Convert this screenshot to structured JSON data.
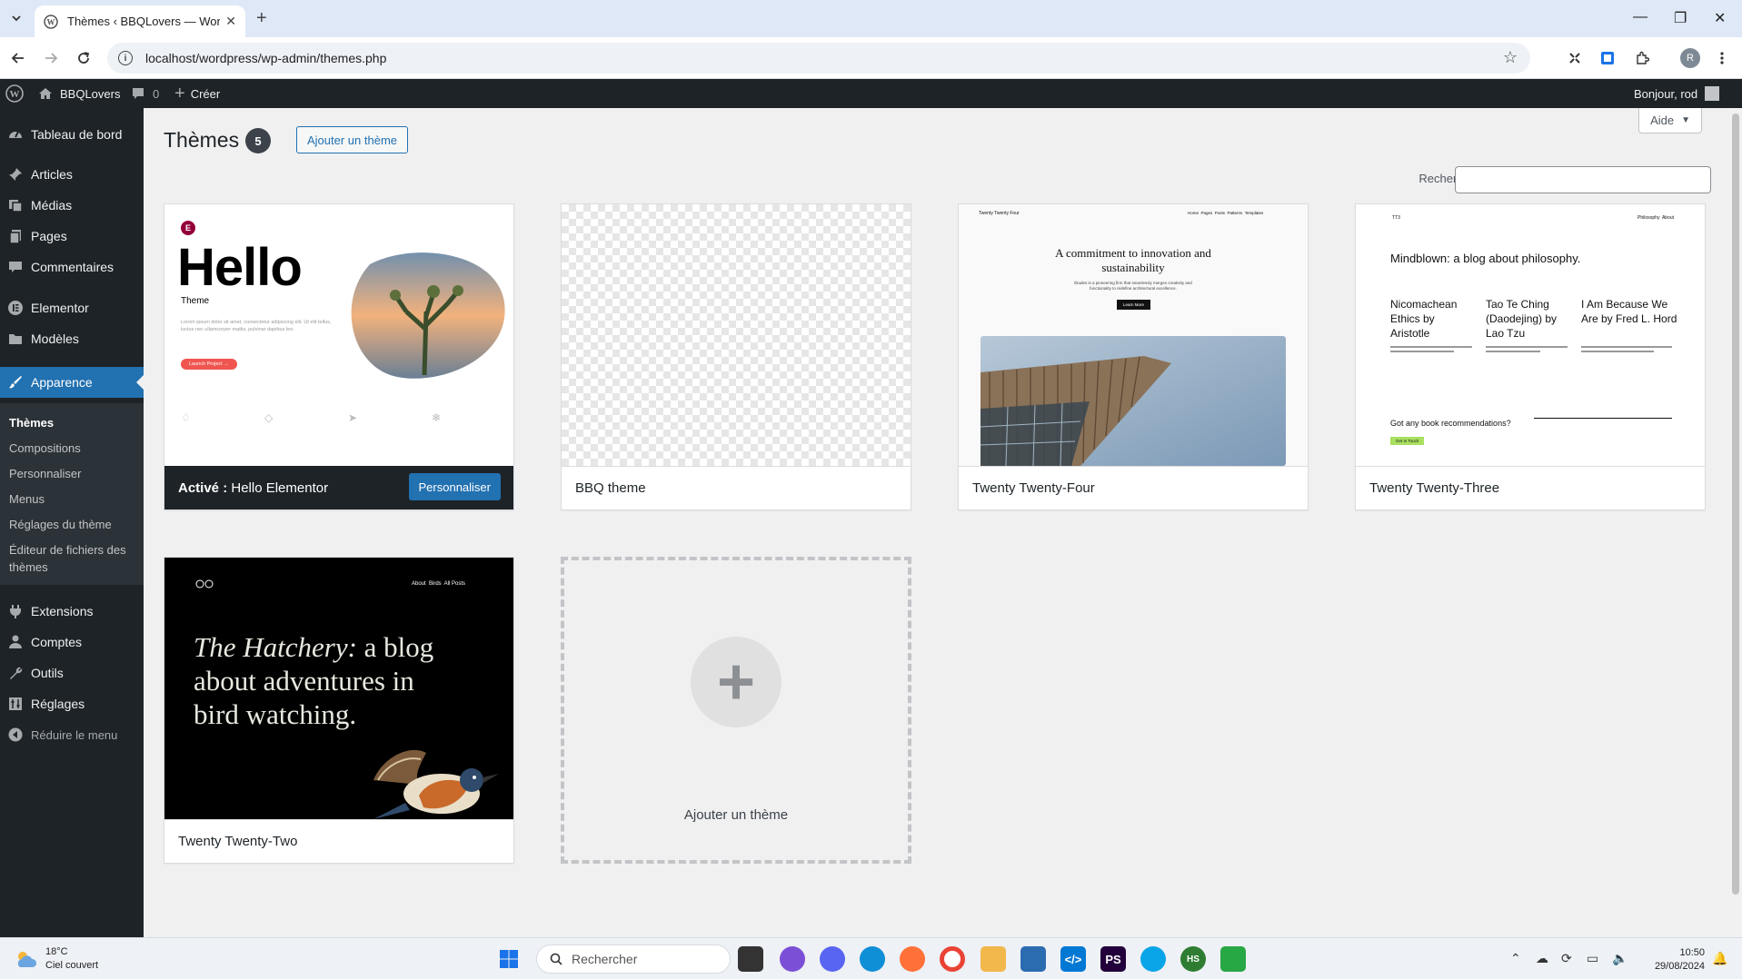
{
  "browser": {
    "tab_title": "Thèmes ‹ BBQLovers — WordPress",
    "url": "localhost/wordpress/wp-admin/themes.php",
    "profile_initial": "R"
  },
  "adminbar": {
    "site_name": "BBQLovers",
    "comments_count": "0",
    "new_label": "Créer",
    "greeting": "Bonjour, rod"
  },
  "sidebar": {
    "items": [
      {
        "label": "Tableau de bord",
        "icon": "dashboard-icon"
      },
      {
        "label": "Articles",
        "icon": "pin-icon"
      },
      {
        "label": "Médias",
        "icon": "media-icon"
      },
      {
        "label": "Pages",
        "icon": "pages-icon"
      },
      {
        "label": "Commentaires",
        "icon": "comment-icon"
      },
      {
        "label": "Elementor",
        "icon": "elementor-icon"
      },
      {
        "label": "Modèles",
        "icon": "folder-icon"
      },
      {
        "label": "Apparence",
        "icon": "brush-icon"
      },
      {
        "label": "Extensions",
        "icon": "plugin-icon"
      },
      {
        "label": "Comptes",
        "icon": "user-icon"
      },
      {
        "label": "Outils",
        "icon": "wrench-icon"
      },
      {
        "label": "Réglages",
        "icon": "settings-icon"
      }
    ],
    "submenu": [
      "Thèmes",
      "Compositions",
      "Personnaliser",
      "Menus",
      "Réglages du thème",
      "Éditeur de fichiers des thèmes"
    ],
    "collapse_label": "Réduire le menu"
  },
  "main": {
    "title": "Thèmes",
    "count": "5",
    "add_button": "Ajouter un thème",
    "help_button": "Aide",
    "search_label": "Rechercher des thèmes installés",
    "themes": [
      {
        "name": "Hello Elementor",
        "active_prefix": "Activé :",
        "customize": "Personnaliser"
      },
      {
        "name": "BBQ theme"
      },
      {
        "name": "Twenty Twenty-Four"
      },
      {
        "name": "Twenty Twenty-Three"
      },
      {
        "name": "Twenty Twenty-Two"
      }
    ],
    "add_new_label": "Ajouter un thème"
  },
  "screenshots": {
    "hello": {
      "brand": "Hello",
      "sub": "Theme",
      "cta": "Launch Project →",
      "body": "Lorem ipsum dolor sit amet, consectetur adipiscing elit. Ut elit tellus, luctus nec ullamcorper mattis, pulvinar dapibus leo."
    },
    "tt4": {
      "brand": "Twenty Twenty Four",
      "headline": "A commitment to innovation and sustainability",
      "body": "Études is a pioneering firm that seamlessly merges creativity and functionality to redefine architectural excellence.",
      "cta": "Learn More",
      "nav": "Home  Pages  Posts  Patterns  Templates"
    },
    "tt3": {
      "brand": "TT3",
      "nav": "Philosophy  About",
      "headline": "Mindblown: a blog about philosophy.",
      "post1": "Nicomachean Ethics by Aristotle",
      "post2": "Tao Te Ching (Daodejing) by Lao Tzu",
      "post3": "I Am Because We Are by Fred L. Hord",
      "question": "Got any book recommendations?",
      "cta": "Get In Touch"
    },
    "tt2": {
      "nav": "About  Birds  All Posts",
      "headline_italic": "The Hatchery:",
      "headline_rest": " a blog about adventures in bird watching."
    }
  },
  "taskbar": {
    "temp": "18°C",
    "condition": "Ciel couvert",
    "search_placeholder": "Rechercher",
    "time": "10:50",
    "date": "29/08/2024"
  },
  "colors": {
    "wp_dark": "#1d2327",
    "wp_blue": "#2271b1"
  }
}
